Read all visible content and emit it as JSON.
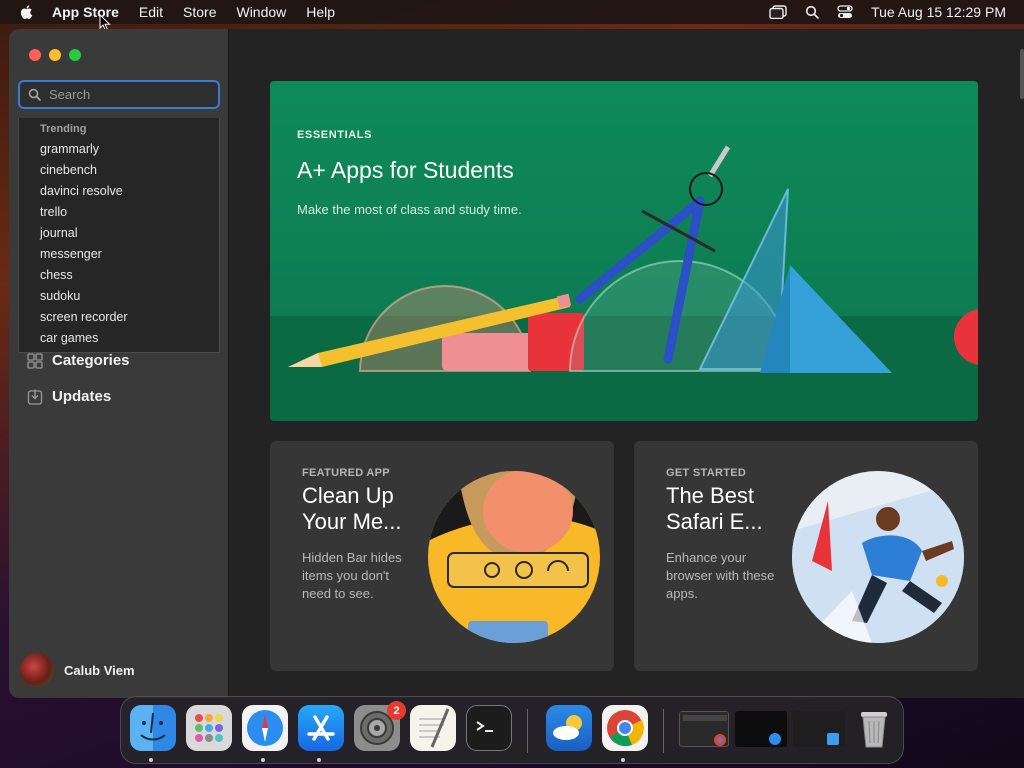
{
  "menubar": {
    "app_name": "App Store",
    "menus": [
      "Edit",
      "Store",
      "Window",
      "Help"
    ],
    "datetime": "Tue Aug 15  12:29 PM"
  },
  "sidebar": {
    "search_placeholder": "Search",
    "suggestions_heading": "Trending",
    "suggestions": [
      "grammarly",
      "cinebench",
      "davinci resolve",
      "trello",
      "journal",
      "messenger",
      "chess",
      "sudoku",
      "screen recorder",
      "car games"
    ],
    "nav": {
      "categories": "Categories",
      "updates": "Updates"
    },
    "user_name": "Calub Viem"
  },
  "hero": {
    "kicker": "ESSENTIALS",
    "title": "A+ Apps for Students",
    "subtitle": "Make the most of class and study time."
  },
  "cards": [
    {
      "kicker": "FEATURED APP",
      "title": "Clean Up Your Me...",
      "desc": "Hidden Bar hides items you don't need to see."
    },
    {
      "kicker": "GET STARTED",
      "title": "The Best Safari E...",
      "desc": "Enhance your browser with these apps."
    }
  ],
  "dock": {
    "settings_badge": "2",
    "apps": [
      "finder-icon",
      "launchpad-icon",
      "safari-icon",
      "app-store-icon",
      "system-settings-icon",
      "textedit-icon",
      "terminal-icon",
      "weather-icon",
      "chrome-icon",
      "chrome-window-thumbnail",
      "dark-window-thumbnail",
      "finder-window-thumbnail",
      "trash-icon"
    ]
  },
  "colors": {
    "hero_green": "#0d7c52",
    "accent_blue": "#3a7bd5",
    "card_bg": "#363636",
    "sidebar_bg": "#3a3a3a"
  }
}
